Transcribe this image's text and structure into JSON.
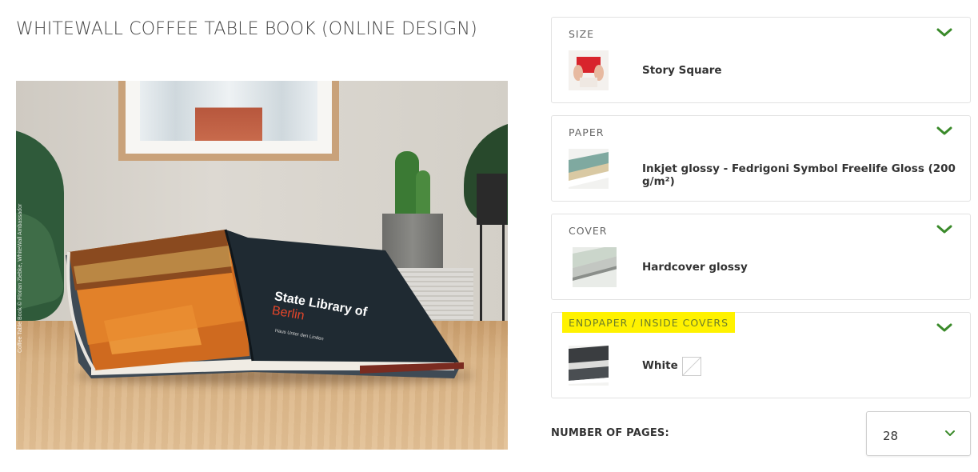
{
  "product": {
    "title": "WHITEWALL COFFEE TABLE BOOK (ONLINE DESIGN)"
  },
  "hero_image": {
    "book_headline": "State Library of",
    "book_headline_accent": "Berlin",
    "book_caption": "Haus Unter den Linden",
    "credit": "Coffee Table Book © Florian Ziebke, WhiteWall Ambassador"
  },
  "options": [
    {
      "label": "SIZE",
      "value": "Story Square",
      "thumb_icon": "hands-holding-red-book-thumbnail"
    },
    {
      "label": "PAPER",
      "value": "Inkjet glossy - Fedrigoni Symbol Freelife Gloss (200 g/m²)",
      "thumb_icon": "open-book-pages-thumbnail"
    },
    {
      "label": "COVER",
      "value": "Hardcover glossy",
      "thumb_icon": "hardcover-corner-thumbnail"
    },
    {
      "label": "ENDPAPER / INSIDE COVERS",
      "value": "White",
      "thumb_icon": "endpaper-thumbnail",
      "highlighted": true,
      "swatch_color": "#ffffff"
    }
  ],
  "pages": {
    "label": "NUMBER OF PAGES:",
    "value": "28"
  },
  "colors": {
    "accent_chevron": "#3a8a2a",
    "highlight": "#fff200"
  }
}
